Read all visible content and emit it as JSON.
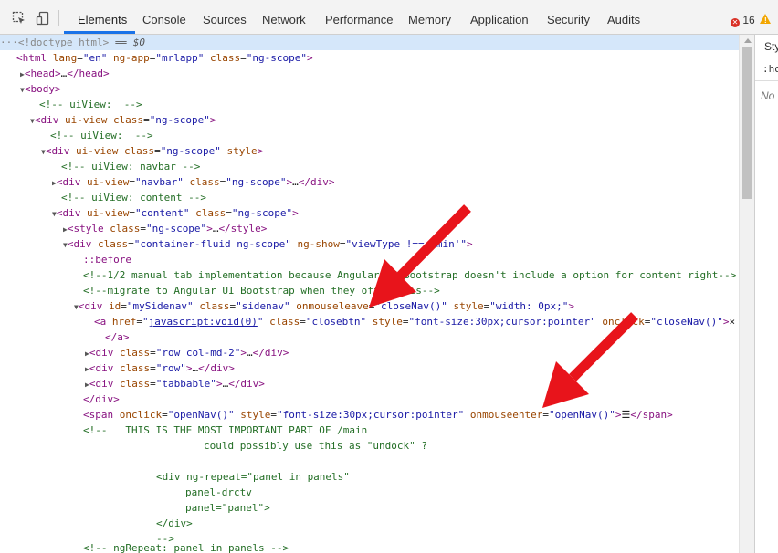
{
  "toolbar": {
    "tabs": [
      "Elements",
      "Console",
      "Sources",
      "Network",
      "Performance",
      "Memory",
      "Application",
      "Security",
      "Audits"
    ],
    "active_tab": "Elements",
    "error_count": "16",
    "inspect_icon": "inspect-element-icon",
    "device_icon": "device-toolbar-icon",
    "warning_icon": "warning-icon"
  },
  "styles_pane": {
    "tab_label": "Sty",
    "hov_label": ":ho",
    "no_label": "No"
  },
  "tree": {
    "l0": {
      "doctype": "<!doctype html>",
      "selected_suffix": " == $0"
    },
    "l1": {
      "tag": "html",
      "a1": "lang",
      "v1": "\"en\"",
      "a2": "ng-app",
      "v2": "\"mrlapp\"",
      "a3": "class",
      "v3": "\"ng-scope\""
    },
    "l2": {
      "tag": "head",
      "ell": "…",
      "close": "</head>"
    },
    "l3": {
      "tag": "body"
    },
    "l4": {
      "comment": "<!-- uiView:  -->"
    },
    "l5": {
      "tag": "div",
      "a1": "ui-view",
      "a2": "class",
      "v2": "\"ng-scope\""
    },
    "l6": {
      "comment": "<!-- uiView:  -->"
    },
    "l7": {
      "tag": "div",
      "a1": "ui-view",
      "a2": "class",
      "v2": "\"ng-scope\"",
      "a3": "style"
    },
    "l8": {
      "comment": "<!-- uiView: navbar -->"
    },
    "l9": {
      "tag": "div",
      "a1": "ui-view",
      "v1": "\"navbar\"",
      "a2": "class",
      "v2": "\"ng-scope\"",
      "ell": "…",
      "close": "</div>"
    },
    "l10": {
      "comment": "<!-- uiView: content -->"
    },
    "l11": {
      "tag": "div",
      "a1": "ui-view",
      "v1": "\"content\"",
      "a2": "class",
      "v2": "\"ng-scope\""
    },
    "l12": {
      "tag": "style",
      "a1": "class",
      "v1": "\"ng-scope\"",
      "ell": "…",
      "close": "</style>"
    },
    "l13": {
      "tag": "div",
      "a1": "class",
      "v1": "\"container-fluid ng-scope\"",
      "a2": "ng-show",
      "v2": "\"viewType !== 'min'\""
    },
    "l14": {
      "pseudo": "::before"
    },
    "l15": {
      "comment": "<!--1/2 manual tab implementation because Angular UI Bootstrap doesn't include a option for content right-->"
    },
    "l16": {
      "comment": "<!--migrate to Angular UI Bootstrap when they offer this-->"
    },
    "l17": {
      "tag": "div",
      "a1": "id",
      "v1": "\"mySidenav\"",
      "a2": "class",
      "v2": "\"sidenav\"",
      "a3": "onmouseleave",
      "v3": "\"closeNav()\"",
      "a4": "style",
      "v4": "\"width: 0px;\""
    },
    "l18": {
      "tag": "a",
      "a1": "href",
      "v1_pre": "\"",
      "v1_link": "javascript:void(0)",
      "v1_post": "\"",
      "a2": "class",
      "v2": "\"closebtn\"",
      "a3": "style",
      "v3": "\"font-size:30px;cursor:pointer\"",
      "a4": "onclick",
      "v4": "\"closeNav()\"",
      "text": "×"
    },
    "l19": {
      "close": "</a>"
    },
    "l20": {
      "tag": "div",
      "a1": "class",
      "v1": "\"row col-md-2\"",
      "ell": "…",
      "close": "</div>"
    },
    "l21": {
      "tag": "div",
      "a1": "class",
      "v1": "\"row\"",
      "ell": "…",
      "close": "</div>"
    },
    "l22": {
      "tag": "div",
      "a1": "class",
      "v1": "\"tabbable\"",
      "ell": "…",
      "close": "</div>"
    },
    "l23": {
      "close": "</div>"
    },
    "l24": {
      "tag": "span",
      "a1": "onclick",
      "v1": "\"openNav()\"",
      "a2": "style",
      "v2": "\"font-size:30px;cursor:pointer\"",
      "a3": "onmouseenter",
      "v3": "\"openNav()\"",
      "text": "☰",
      "close": "</span>"
    },
    "l25": {
      "comment": "<!--   THIS IS THE MOST IMPORTANT PART OF /main"
    },
    "l26": {
      "comment": "could possibly use this as \"undock\" ?"
    },
    "l27": {
      "comment": "<div ng-repeat=\"panel in panels\""
    },
    "l28": {
      "comment": "panel-drctv"
    },
    "l29": {
      "comment": "panel=\"panel\">"
    },
    "l30": {
      "comment": "</div>"
    },
    "l31": {
      "comment": "-->"
    },
    "l32": {
      "comment": "<!-- ngRepeat: panel in panels -->"
    }
  },
  "colors": {
    "tag": "#881280",
    "attr": "#994500",
    "value": "#1a1aa6",
    "comment": "#236e25",
    "selection": "#d5e7fa",
    "annotation_arrow": "#e8141b",
    "active_tab_underline": "#1a73e8"
  },
  "annotations": [
    "red-arrow-onmouseleave",
    "red-arrow-onmouseenter"
  ]
}
